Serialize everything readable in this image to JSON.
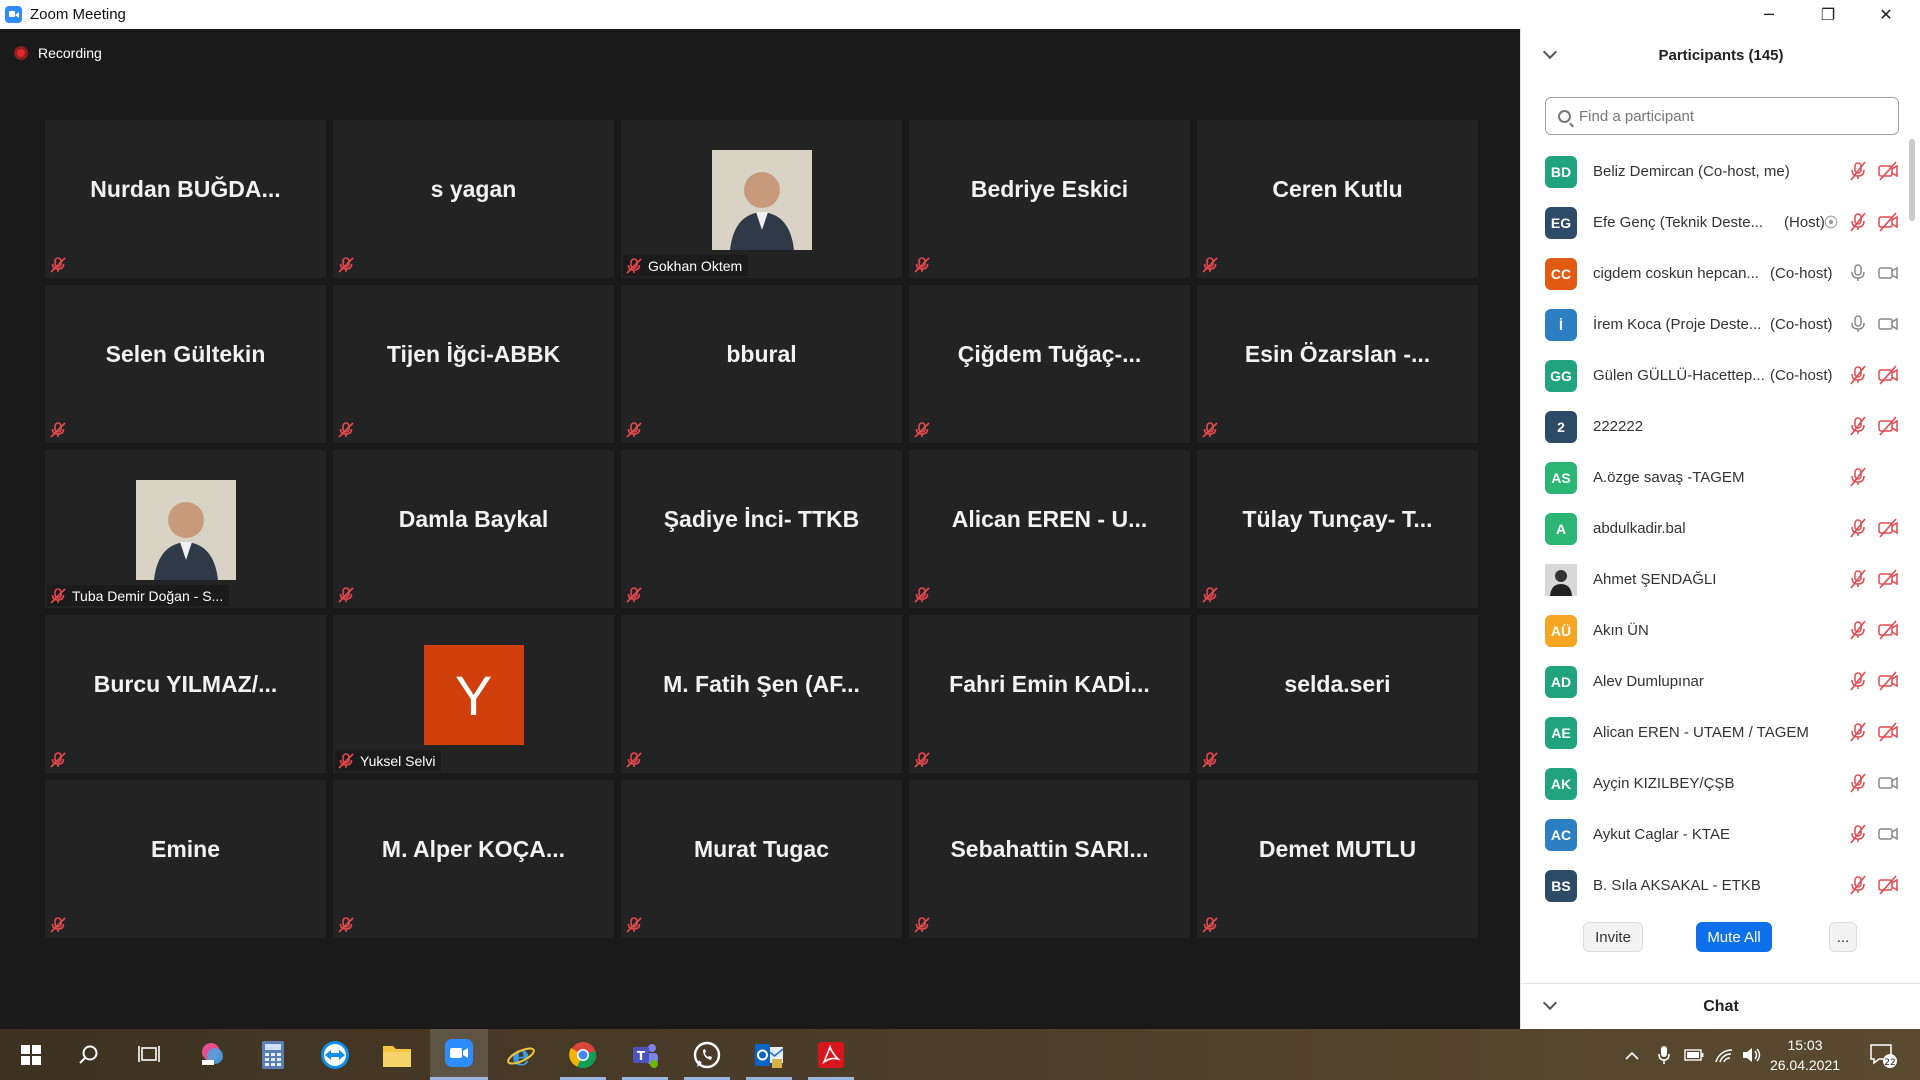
{
  "window": {
    "title": "Zoom Meeting",
    "minimize": "─",
    "maximize": "❐",
    "close": "✕"
  },
  "recording": {
    "label": "Recording"
  },
  "tiles": [
    {
      "name": "Nurdan BUĞDA...",
      "type": "name"
    },
    {
      "name": "s yagan",
      "type": "name"
    },
    {
      "name": "Gokhan Oktem",
      "type": "photo"
    },
    {
      "name": "Bedriye Eskici",
      "type": "name"
    },
    {
      "name": "Ceren Kutlu",
      "type": "name"
    },
    {
      "name": "Selen Gültekin",
      "type": "name"
    },
    {
      "name": "Tijen İğci-ABBK",
      "type": "name"
    },
    {
      "name": "bbural",
      "type": "name"
    },
    {
      "name": "Çiğdem  Tuğaç-...",
      "type": "name"
    },
    {
      "name": "Esin  Özarslan  -...",
      "type": "name"
    },
    {
      "name": "Tuba Demir Doğan - S...",
      "type": "photo"
    },
    {
      "name": "Damla Baykal",
      "type": "name"
    },
    {
      "name": "Şadiye İnci- TTKB",
      "type": "name"
    },
    {
      "name": "Alican  EREN  -  U...",
      "type": "name"
    },
    {
      "name": "Tülay  Tunçay-  T...",
      "type": "name"
    },
    {
      "name": "Burcu  YILMAZ/...",
      "type": "name"
    },
    {
      "name": "Yuksel Selvi",
      "type": "letter",
      "letter": "Y"
    },
    {
      "name": "M.  Fatih  Şen  (AF...",
      "type": "name"
    },
    {
      "name": "Fahri  Emin  KADİ...",
      "type": "name"
    },
    {
      "name": "selda.seri",
      "type": "name"
    },
    {
      "name": "Emine",
      "type": "name"
    },
    {
      "name": "M.  Alper  KOÇA...",
      "type": "name"
    },
    {
      "name": "Murat Tugac",
      "type": "name"
    },
    {
      "name": "Sebahattin  SARI...",
      "type": "name"
    },
    {
      "name": "Demet MUTLU",
      "type": "name"
    }
  ],
  "panel": {
    "title": "Participants (145)",
    "search_placeholder": "Find a participant",
    "invite": "Invite",
    "mute_all": "Mute All",
    "more": "...",
    "chat": "Chat"
  },
  "participants": [
    {
      "initials": "BD",
      "color": "#21a47d",
      "name": "Beliz Demircan (Co-host, me)",
      "role": "",
      "mic": "muted",
      "video": "off",
      "extra": ""
    },
    {
      "initials": "EG",
      "color": "#2d4a66",
      "name": "Efe Genç (Teknik Deste...",
      "role": "(Host)",
      "mic": "muted",
      "video": "off",
      "extra": "record"
    },
    {
      "initials": "CC",
      "color": "#e05a11",
      "name": "cigdem coskun hepcan...",
      "role": "(Co-host)",
      "mic": "on",
      "video": "on",
      "extra": ""
    },
    {
      "initials": "İ",
      "color": "#2d7fc4",
      "name": "İrem Koca (Proje Deste...",
      "role": "(Co-host)",
      "mic": "on",
      "video": "on",
      "extra": ""
    },
    {
      "initials": "GG",
      "color": "#21a47d",
      "name": "Gülen GÜLLÜ-Hacettep...",
      "role": "(Co-host)",
      "mic": "muted",
      "video": "off",
      "extra": ""
    },
    {
      "initials": "2",
      "color": "#2d4a66",
      "name": "222222",
      "role": "",
      "mic": "muted",
      "video": "off",
      "extra": ""
    },
    {
      "initials": "AS",
      "color": "#2bb673",
      "name": "A.özge savaş -TAGEM",
      "role": "",
      "mic": "muted",
      "video": "none",
      "extra": ""
    },
    {
      "initials": "A",
      "color": "#2bb673",
      "name": "abdulkadir.bal",
      "role": "",
      "mic": "muted",
      "video": "off",
      "extra": ""
    },
    {
      "initials": "",
      "color": "#3a3a3a",
      "name": "Ahmet ŞENDAĞLI",
      "role": "",
      "mic": "muted",
      "video": "off",
      "extra": "photo"
    },
    {
      "initials": "AÜ",
      "color": "#f5a623",
      "name": "Akın ÜN",
      "role": "",
      "mic": "muted",
      "video": "off",
      "extra": ""
    },
    {
      "initials": "AD",
      "color": "#21a47d",
      "name": "Alev Dumlupınar",
      "role": "",
      "mic": "muted",
      "video": "off",
      "extra": ""
    },
    {
      "initials": "AE",
      "color": "#21a47d",
      "name": "Alican EREN - UTAEM / TAGEM",
      "role": "",
      "mic": "muted",
      "video": "off",
      "extra": ""
    },
    {
      "initials": "AK",
      "color": "#21a47d",
      "name": "Ayçin KIZILBEY/ÇŞB",
      "role": "",
      "mic": "muted",
      "video": "on",
      "extra": ""
    },
    {
      "initials": "AC",
      "color": "#2d7fc4",
      "name": "Aykut Caglar - KTAE",
      "role": "",
      "mic": "muted",
      "video": "on",
      "extra": ""
    },
    {
      "initials": "BS",
      "color": "#2d4a66",
      "name": "B. Sıla AKSAKAL - ETKB",
      "role": "",
      "mic": "muted",
      "video": "off",
      "extra": ""
    }
  ],
  "taskbar": {
    "time": "15:03",
    "date": "26.04.2021",
    "notifications": "22"
  }
}
